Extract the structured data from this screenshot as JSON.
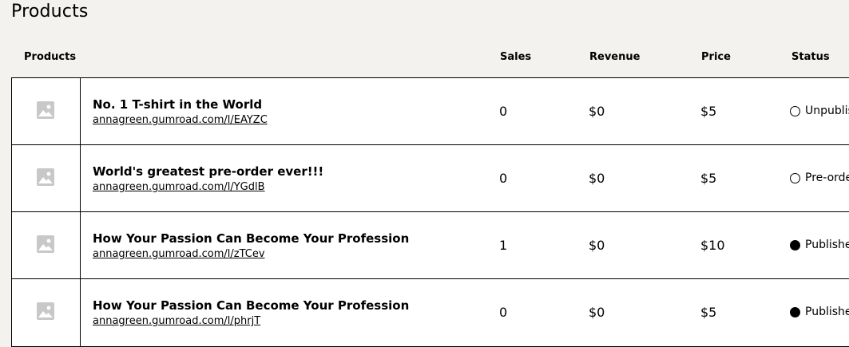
{
  "page": {
    "title": "Products"
  },
  "table": {
    "headers": {
      "product": "Products",
      "sales": "Sales",
      "revenue": "Revenue",
      "price": "Price",
      "status": "Status"
    },
    "rows": [
      {
        "name": "No. 1 T-shirt in the World",
        "url": "annagreen.gumroad.com/l/EAYZC",
        "sales": "0",
        "revenue": "$0",
        "price": "$5",
        "status": "Unpublished",
        "status_icon": "circle-outline-icon"
      },
      {
        "name": "World's greatest pre-order ever!!!",
        "url": "annagreen.gumroad.com/l/YGdlB",
        "sales": "0",
        "revenue": "$0",
        "price": "$5",
        "status": "Pre-order",
        "status_icon": "circle-outline-icon"
      },
      {
        "name": "How Your Passion Can Become Your Profession",
        "url": "annagreen.gumroad.com/l/zTCev",
        "sales": "1",
        "revenue": "$0",
        "price": "$10",
        "status": "Published",
        "status_icon": "circle-filled-icon"
      },
      {
        "name": "How Your Passion Can Become Your Profession",
        "url": "annagreen.gumroad.com/l/phrjT",
        "sales": "0",
        "revenue": "$0",
        "price": "$5",
        "status": "Published",
        "status_icon": "circle-filled-icon"
      }
    ]
  },
  "colors": {
    "background": "#f3f2ee",
    "table_background": "#ffffff",
    "border": "#000000",
    "placeholder_icon": "#c8c8c8"
  }
}
